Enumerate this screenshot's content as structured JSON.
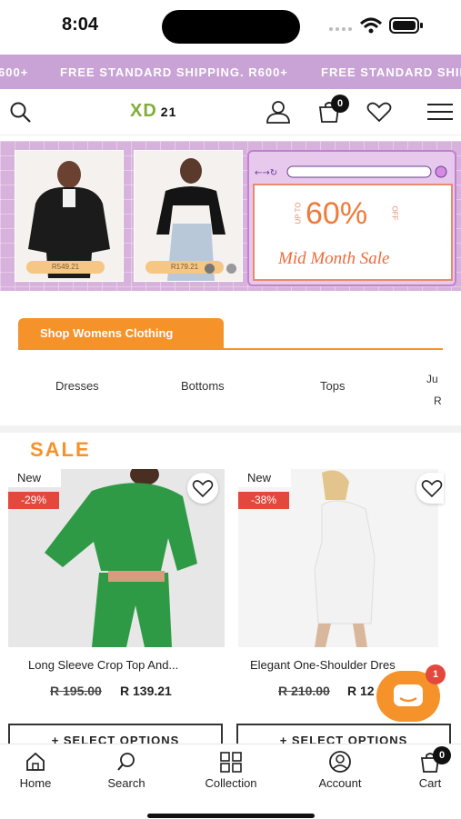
{
  "status": {
    "time": "8:04"
  },
  "promo": {
    "items": [
      "600+",
      "FREE STANDARD SHIPPING. R600+",
      "FREE STANDARD SHIP"
    ]
  },
  "header": {
    "logo": "XD",
    "logo_suffix": "21",
    "cart_count": "0"
  },
  "banner": {
    "photo1_price": "R549.21",
    "photo2_price": "R179.21",
    "sale_upto": "UP TO",
    "sale_percent": "60%",
    "sale_off": "OFF",
    "sale_title": "Mid Month Sale"
  },
  "shop": {
    "tab_label": "Shop Womens Clothing",
    "categories": [
      "Dresses",
      "Bottoms",
      "Tops",
      "Ju",
      "R"
    ]
  },
  "sale_heading": "SALE",
  "products": [
    {
      "tag": "New",
      "discount": "-29%",
      "name": "Long Sleeve Crop Top And...",
      "old_price": "R 195.00",
      "price": "R 139.21",
      "button": "+ SELECT OPTIONS"
    },
    {
      "tag": "New",
      "discount": "-38%",
      "name": "Elegant One-Shoulder Dres",
      "old_price": "R 210.00",
      "price": "R 12",
      "button": "+ SELECT OPTIONS"
    }
  ],
  "chat": {
    "badge": "1"
  },
  "bottom_nav": {
    "home": "Home",
    "search": "Search",
    "collection": "Collection",
    "account": "Account",
    "cart": "Cart",
    "cart_count": "0"
  },
  "colors": {
    "accent": "#f6922a",
    "promo_bg": "#c9a3d6",
    "discount": "#e4473c",
    "logo_green": "#7fae3b"
  }
}
